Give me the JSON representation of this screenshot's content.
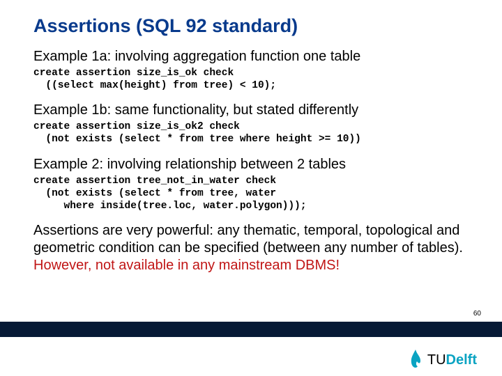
{
  "title": "Assertions (SQL 92 standard)",
  "ex1a": {
    "heading": "Example 1a: involving aggregation function one table",
    "code": "create assertion size_is_ok check\n  ((select max(height) from tree) < 10);"
  },
  "ex1b": {
    "heading": "Example 1b: same functionality, but stated differently",
    "code": "create assertion size_is_ok2 check\n  (not exists (select * from tree where height >= 10))"
  },
  "ex2": {
    "heading": "Example 2: involving relationship between 2 tables",
    "code": "create assertion tree_not_in_water check\n  (not exists (select * from tree, water\n     where inside(tree.loc, water.polygon)));"
  },
  "body": "Assertions are very powerful: any thematic, temporal, topological and geometric condition can be specified (between any number of tables).",
  "warning": "However, not available in any mainstream DBMS!",
  "page_number": "60",
  "logo": {
    "tu": "TU",
    "delft": "Delft"
  }
}
